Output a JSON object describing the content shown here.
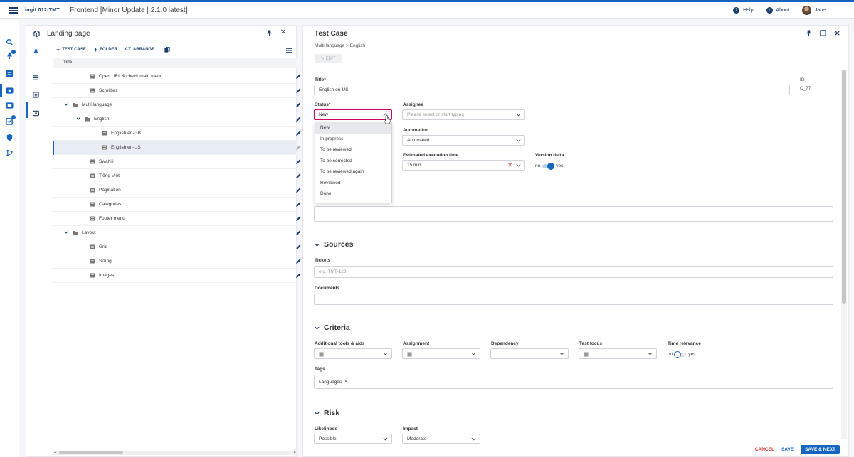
{
  "app": {
    "logo_text": "ingit 012-TMT",
    "project_title": "Frontend [Minor Update | 2.1.0 latest]",
    "help_label": "Help",
    "about_label": "About",
    "user_name": "Jane"
  },
  "left_nav": {
    "icons": [
      "search-icon",
      "pin-icon",
      "list-icon",
      "test-case-icon",
      "folder-icon",
      "tasks-icon",
      "shield-icon",
      "branch-icon"
    ]
  },
  "tree_panel": {
    "title": "Landing page",
    "toolbar": {
      "add_test_case_label": "TEST CASE",
      "add_folder_label": "FOLDER",
      "arrange_label": "ARRANGE",
      "arrange_prefix": "CT"
    },
    "column_title": "Title",
    "rows": [
      {
        "label": "Open URL & check main menu",
        "level": 1,
        "type": "case",
        "expand": false,
        "selected": false
      },
      {
        "label": "Scrollbar",
        "level": 1,
        "type": "case",
        "expand": false,
        "selected": false
      },
      {
        "label": "Multi language",
        "level": 0,
        "type": "folder",
        "expand": true,
        "selected": false
      },
      {
        "label": "English",
        "level": 1,
        "type": "folder",
        "expand": true,
        "selected": false
      },
      {
        "label": "English en-GB",
        "level": 2,
        "type": "case",
        "expand": false,
        "selected": false
      },
      {
        "label": "English en-US",
        "level": 2,
        "type": "case",
        "expand": false,
        "selected": true
      },
      {
        "label": "Swahili",
        "level": 1,
        "type": "case",
        "expand": false,
        "selected": false
      },
      {
        "label": "Tiếng Việt",
        "level": 1,
        "type": "case",
        "expand": false,
        "selected": false
      },
      {
        "label": "Pagination",
        "level": 1,
        "type": "case",
        "expand": false,
        "selected": false
      },
      {
        "label": "Categories",
        "level": 1,
        "type": "case",
        "expand": false,
        "selected": false
      },
      {
        "label": "Footer menu",
        "level": 1,
        "type": "case",
        "expand": false,
        "selected": false
      },
      {
        "label": "Layout",
        "level": 0,
        "type": "folder",
        "expand": true,
        "selected": false
      },
      {
        "label": "Grid",
        "level": 1,
        "type": "case",
        "expand": false,
        "selected": false
      },
      {
        "label": "Sizing",
        "level": 1,
        "type": "case",
        "expand": false,
        "selected": false
      },
      {
        "label": "Images",
        "level": 1,
        "type": "case",
        "expand": false,
        "selected": false
      }
    ]
  },
  "detail": {
    "title": "Test Case",
    "breadcrumb": "Multi language  >  English",
    "edit_label": "EDIT",
    "title_label": "Title*",
    "title_value": "English en-US",
    "id_label": "ID",
    "id_value": "C_77",
    "status_label": "Status*",
    "status_value": "New",
    "status_options": [
      "New",
      "In progress",
      "To be reviewed",
      "To be corrected",
      "To be reviewed again",
      "Reviewed",
      "Done"
    ],
    "assignee_label": "Assignee",
    "assignee_placeholder": "Please select or start typing",
    "automation_label": "Automation",
    "automation_value": "Automated",
    "exec_time_label": "Estimated execution time",
    "exec_time_value": "15 min",
    "version_delta_label": "Version delta",
    "version_delta_no": "no",
    "version_delta_yes": "yes",
    "sources_title": "Sources",
    "tickets_label": "Tickets",
    "tickets_placeholder": "e.g. TMT-123",
    "documents_label": "Documents",
    "criteria_title": "Criteria",
    "tools_label": "Additional tools & aids",
    "assignment_label": "Assignment",
    "dependency_label": "Dependency",
    "test_focus_label": "Test focus",
    "time_relevance_label": "Time relevance",
    "time_relevance_no": "no",
    "time_relevance_yes": "yes",
    "tags_label": "Tags",
    "tag_value": "Languages",
    "risk_title": "Risk",
    "likelihood_label": "Likelihood",
    "likelihood_value": "Possible",
    "impact_label": "Impact",
    "impact_value": "Moderate",
    "cancel_label": "CANCEL",
    "save_label": "SAVE",
    "save_next_label": "SAVE & NEXT"
  },
  "colors": {
    "brand": "#1565c0",
    "navy": "#1a3d6b",
    "danger": "#d32f2f",
    "focus": "#d4006a"
  }
}
